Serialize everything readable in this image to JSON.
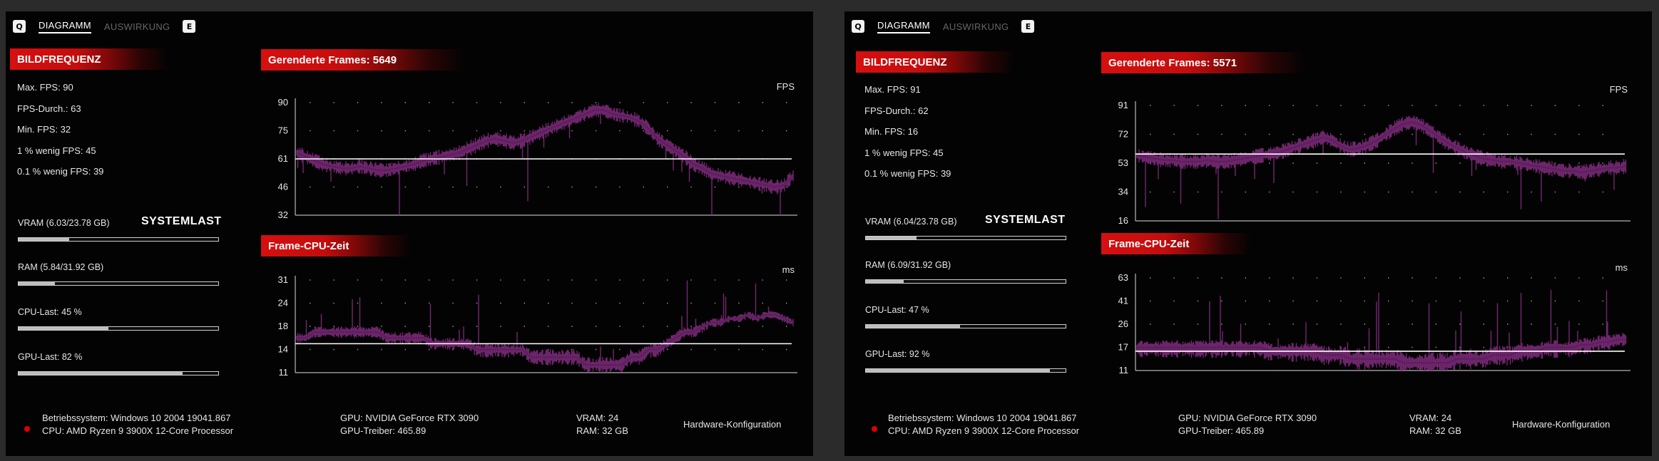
{
  "panels": [
    {
      "tabs": {
        "left_key": "Q",
        "active_label": "DIAGRAMM",
        "inactive_label": "AUSWIRKUNG",
        "right_key": "E"
      },
      "fps_section": {
        "header": "BILDFREQUENZ",
        "max": "Max. FPS: 90",
        "avg": "FPS-Durch.: 63",
        "min": "Min. FPS: 32",
        "low1": "1 % wenig FPS: 45",
        "low01": "0.1 % wenig FPS: 39"
      },
      "system_load": {
        "title": "SYSTEMLAST",
        "vram": {
          "label": "VRAM (6.03/23.78 GB)",
          "fraction": 0.254
        },
        "ram": {
          "label": "RAM (5.84/31.92 GB)",
          "fraction": 0.183
        },
        "cpu": {
          "label": "CPU-Last: 45 %",
          "fraction": 0.45
        },
        "gpu": {
          "label": "GPU-Last: 82 %",
          "fraction": 0.82
        }
      },
      "frames_header": "Gerenderte Frames: 5649",
      "cpu_header": "Frame-CPU-Zeit",
      "footer": {
        "os": "Betriebssystem: Windows 10 2004 19041.867",
        "cpu": "CPU: AMD Ryzen 9 3900X 12-Core Processor",
        "gpu": "GPU: NVIDIA GeForce RTX 3090",
        "driver": "GPU-Treiber: 465.89",
        "vram": "VRAM: 24",
        "ram": "RAM: 32 GB",
        "hw_config": "Hardware-Konfiguration"
      }
    },
    {
      "tabs": {
        "left_key": "Q",
        "active_label": "DIAGRAMM",
        "inactive_label": "AUSWIRKUNG",
        "right_key": "E"
      },
      "fps_section": {
        "header": "BILDFREQUENZ",
        "max": "Max. FPS: 91",
        "avg": "FPS-Durch.: 62",
        "min": "Min. FPS: 16",
        "low1": "1 % wenig FPS: 45",
        "low01": "0.1 % wenig FPS: 39"
      },
      "system_load": {
        "title": "SYSTEMLAST",
        "vram": {
          "label": "VRAM (6.04/23.78 GB)",
          "fraction": 0.254
        },
        "ram": {
          "label": "RAM (6.09/31.92 GB)",
          "fraction": 0.191
        },
        "cpu": {
          "label": "CPU-Last: 47 %",
          "fraction": 0.47
        },
        "gpu": {
          "label": "GPU-Last: 92 %",
          "fraction": 0.92
        }
      },
      "frames_header": "Gerenderte Frames: 5571",
      "cpu_header": "Frame-CPU-Zeit",
      "footer": {
        "os": "Betriebssystem: Windows 10 2004 19041.867",
        "cpu": "CPU: AMD Ryzen 9 3900X 12-Core Processor",
        "gpu": "GPU: NVIDIA GeForce RTX 3090",
        "driver": "GPU-Treiber: 465.89",
        "vram": "VRAM: 24",
        "ram": "RAM: 32 GB",
        "hw_config": "Hardware-Konfiguration"
      }
    }
  ],
  "colors": {
    "accent_red": "#d70f0f",
    "series_purple": "#7a2a78",
    "average_line": "#ffffff"
  },
  "chart_data": [
    {
      "type": "line",
      "panel": 0,
      "unit": "FPS",
      "yticks": [
        32,
        46,
        61,
        75,
        90
      ],
      "ylim": [
        32,
        90
      ],
      "average": 61,
      "series": [
        {
          "values": [
            64,
            62,
            60,
            58,
            57,
            56,
            56,
            57,
            56,
            55,
            55,
            56,
            57,
            58,
            60,
            61,
            62,
            63,
            64,
            66,
            68,
            70,
            71,
            70,
            69,
            70,
            72,
            74,
            76,
            78,
            80,
            82,
            84,
            86,
            86,
            84,
            83,
            82,
            80,
            76,
            71,
            68,
            65,
            62,
            58,
            56,
            53,
            52,
            51,
            50,
            49,
            48,
            47,
            46,
            47,
            52
          ]
        }
      ]
    },
    {
      "type": "line",
      "panel": 0,
      "unit": "ms",
      "yticks": [
        11,
        14,
        18,
        24,
        31
      ],
      "ylim": [
        11,
        31
      ],
      "average": 15,
      "series": [
        {
          "values": [
            16,
            16,
            17,
            17,
            17,
            17,
            17,
            17,
            17,
            17,
            16,
            16,
            16,
            16,
            16,
            15,
            15,
            15,
            15,
            15,
            14,
            14,
            14,
            14,
            14,
            14,
            13,
            13,
            13,
            13,
            13,
            13,
            12,
            12,
            12,
            12,
            12,
            13,
            13,
            14,
            14,
            15,
            16,
            17,
            17,
            18,
            19,
            19,
            20,
            20,
            21,
            20,
            21,
            21,
            20,
            19
          ]
        }
      ]
    },
    {
      "type": "line",
      "panel": 1,
      "unit": "FPS",
      "yticks": [
        16,
        34,
        53,
        72,
        91
      ],
      "ylim": [
        16,
        91
      ],
      "average": 59,
      "series": [
        {
          "values": [
            58,
            57,
            56,
            55,
            55,
            54,
            54,
            54,
            55,
            54,
            54,
            55,
            56,
            57,
            58,
            59,
            60,
            62,
            64,
            66,
            68,
            70,
            68,
            64,
            62,
            63,
            65,
            68,
            72,
            76,
            79,
            80,
            78,
            74,
            70,
            66,
            63,
            60,
            58,
            56,
            55,
            54,
            54,
            53,
            52,
            51,
            50,
            49,
            48,
            48,
            47,
            48,
            49,
            50,
            50,
            51
          ]
        }
      ]
    },
    {
      "type": "line",
      "panel": 1,
      "unit": "ms",
      "yticks": [
        11,
        17,
        26,
        41,
        63
      ],
      "ylim": [
        11,
        63
      ],
      "average": 16,
      "series": [
        {
          "values": [
            17,
            17,
            17,
            17,
            17,
            17,
            17,
            17,
            17,
            17,
            17,
            17,
            17,
            17,
            17,
            16,
            16,
            16,
            16,
            16,
            16,
            15,
            15,
            15,
            14,
            14,
            14,
            14,
            14,
            14,
            13,
            13,
            13,
            13,
            13,
            13,
            14,
            14,
            14,
            14,
            15,
            15,
            15,
            16,
            16,
            16,
            17,
            17,
            17,
            17,
            18,
            18,
            19,
            19,
            20,
            20
          ]
        }
      ]
    }
  ]
}
